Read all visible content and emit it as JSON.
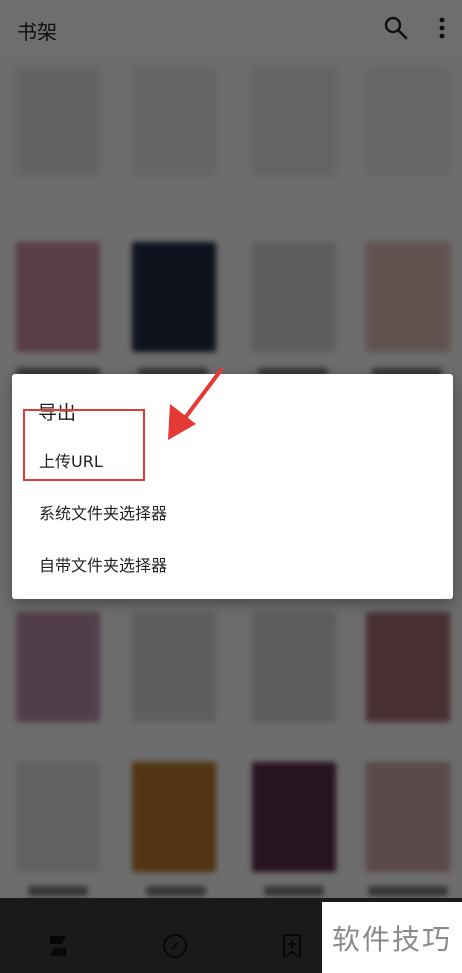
{
  "app_bar": {
    "title": "书架",
    "search_icon": "search-icon",
    "more_icon": "more-vert-icon"
  },
  "dialog": {
    "title": "导出",
    "items": [
      {
        "label": "上传URL"
      },
      {
        "label": "系统文件夹选择器"
      },
      {
        "label": "自带文件夹选择器"
      }
    ]
  },
  "bottom_nav": {
    "items": [
      {
        "icon": "bookshelf-icon"
      },
      {
        "icon": "compass-icon"
      },
      {
        "icon": "bookmark-add-icon"
      }
    ]
  },
  "annotation": {
    "highlight_color": "#e53935"
  },
  "watermark": {
    "text": "软件技巧"
  }
}
